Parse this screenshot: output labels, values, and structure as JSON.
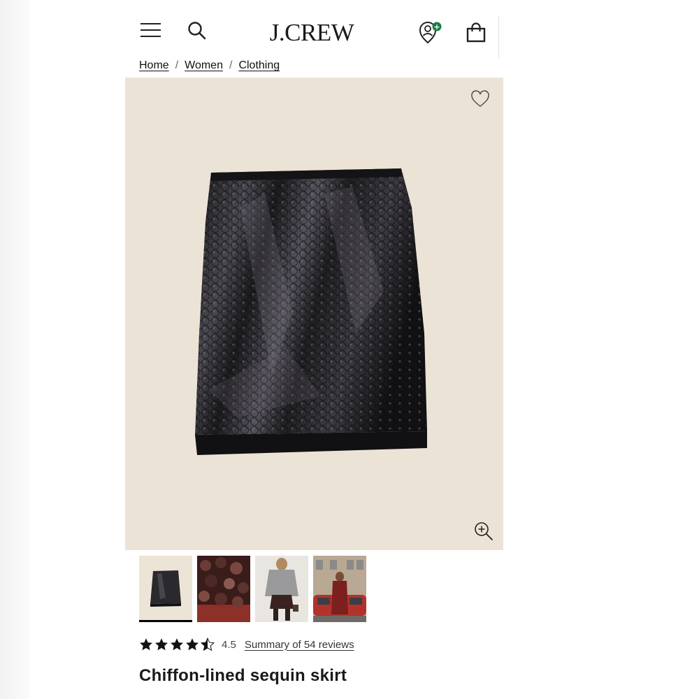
{
  "header": {
    "logo_text": "J.CREW",
    "icons": [
      "hamburger-menu-icon",
      "search-icon",
      "account-icon",
      "shopping-bag-icon"
    ],
    "account_badge": "+"
  },
  "breadcrumb": {
    "items": [
      "Home",
      "Women",
      "Clothing"
    ],
    "separator": "/"
  },
  "product": {
    "title": "Chiffon-lined sequin skirt",
    "rating_value": "4.5",
    "rating": 4.5,
    "rating_max": 5,
    "reviews_link": "Summary of 54 reviews",
    "thumbnail_count": 4,
    "active_thumbnail": 0
  },
  "colors": {
    "hero_bg": "#ebe3d5",
    "account_badge": "#1e7a46",
    "text": "#111111"
  }
}
